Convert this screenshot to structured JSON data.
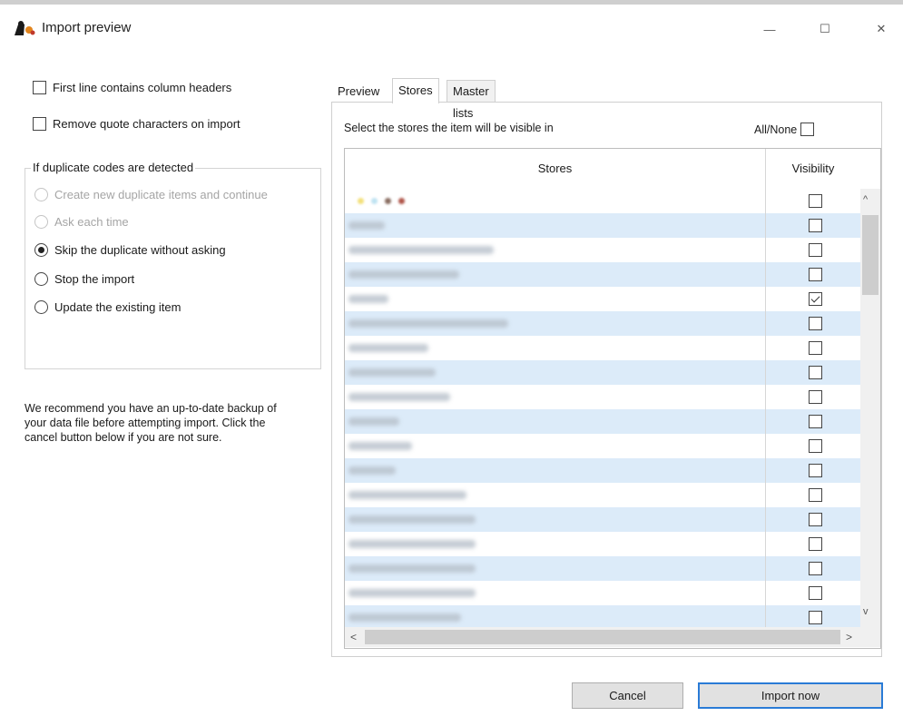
{
  "window": {
    "title": "Import preview",
    "minimize": "—",
    "maximize": "☐",
    "close": "✕"
  },
  "options": {
    "first_line_headers": "First line contains column headers",
    "remove_quotes": "Remove quote characters on import"
  },
  "duplicates": {
    "legend": "If duplicate codes are detected",
    "choices": [
      {
        "label": "Create new duplicate items and continue",
        "selected": false,
        "enabled": false
      },
      {
        "label": "Ask each time",
        "selected": false,
        "enabled": false
      },
      {
        "label": "Skip the duplicate without asking",
        "selected": true,
        "enabled": true
      },
      {
        "label": "Stop the import",
        "selected": false,
        "enabled": true
      },
      {
        "label": "Update the existing item",
        "selected": false,
        "enabled": true
      }
    ]
  },
  "note": "We recommend you have an up-to-date backup of your data file before attempting import. Click the cancel button below if you are not sure.",
  "tabs": [
    "Preview",
    "Stores",
    "Master lists"
  ],
  "stores_tab": {
    "instruction": "Select the stores the item will be visible in",
    "all_none": "All/None",
    "columns": {
      "stores": "Stores",
      "visibility": "Visibility"
    },
    "rows": [
      {
        "checked": false
      },
      {
        "checked": false
      },
      {
        "checked": false
      },
      {
        "checked": false
      },
      {
        "checked": true
      },
      {
        "checked": false
      },
      {
        "checked": false
      },
      {
        "checked": false
      },
      {
        "checked": false
      },
      {
        "checked": false
      },
      {
        "checked": false
      },
      {
        "checked": false
      },
      {
        "checked": false
      },
      {
        "checked": false
      },
      {
        "checked": false
      },
      {
        "checked": false
      },
      {
        "checked": false
      },
      {
        "checked": false
      }
    ]
  },
  "scroll": {
    "up": "^",
    "down": "v",
    "left": "<",
    "right": ">"
  },
  "buttons": {
    "cancel": "Cancel",
    "import": "Import now"
  }
}
